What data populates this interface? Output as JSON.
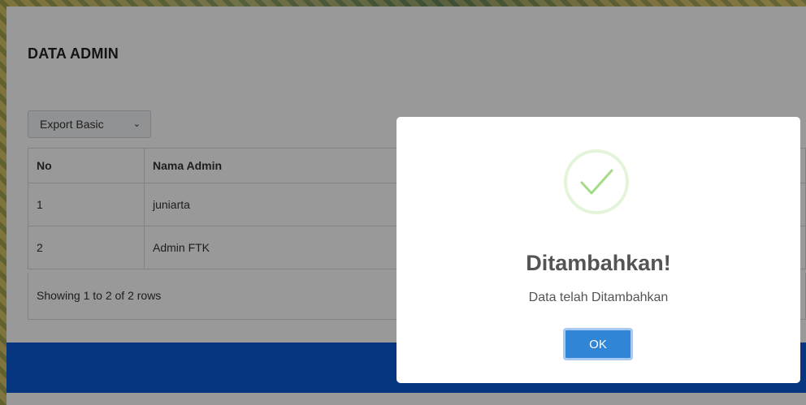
{
  "page": {
    "title": "DATA ADMIN"
  },
  "export": {
    "selected": "Export Basic",
    "chevron_icon": "chevron-down-icon"
  },
  "table": {
    "columns": [
      "No",
      "Nama Admin"
    ],
    "rows": [
      {
        "no": "1",
        "nama": "juniarta"
      },
      {
        "no": "2",
        "nama": "Admin FTK"
      }
    ],
    "pagination_text": "Showing 1 to 2 of 2 rows"
  },
  "modal": {
    "icon": "success-check-icon",
    "title": "Ditambahkan!",
    "text": "Data telah Ditambahkan",
    "ok_label": "OK"
  },
  "colors": {
    "footer": "#0d5bd8",
    "ok_button": "#3085d6",
    "success": "#a5dc86"
  }
}
